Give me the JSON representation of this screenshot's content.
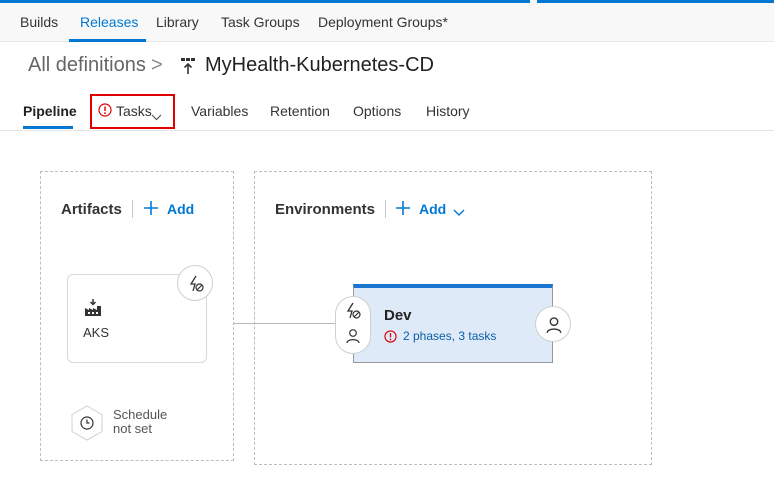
{
  "topnav": {
    "items": [
      "Builds",
      "Releases",
      "Library",
      "Task Groups",
      "Deployment Groups*"
    ],
    "active": "Releases"
  },
  "breadcrumb": {
    "root": "All definitions",
    "separator": ">",
    "title": "MyHealth-Kubernetes-CD"
  },
  "tabs": [
    "Pipeline",
    "Tasks",
    "Variables",
    "Retention",
    "Options",
    "History"
  ],
  "pipeline": {
    "artifacts": {
      "title": "Artifacts",
      "add_label": "Add",
      "items": [
        {
          "name": "AKS",
          "icon": "build-artifact-icon"
        }
      ],
      "schedule": {
        "line1": "Schedule",
        "line2": "not set",
        "icon": "clock-icon"
      }
    },
    "environments": {
      "title": "Environments",
      "add_label": "Add",
      "items": [
        {
          "name": "Dev",
          "status": "2 phases, 3 tasks",
          "status_icon": "error-icon"
        }
      ]
    }
  },
  "colors": {
    "accent": "#0078d4",
    "error": "#e00000",
    "env_fill": "#deeaf7",
    "env_top": "#1b75d0"
  }
}
